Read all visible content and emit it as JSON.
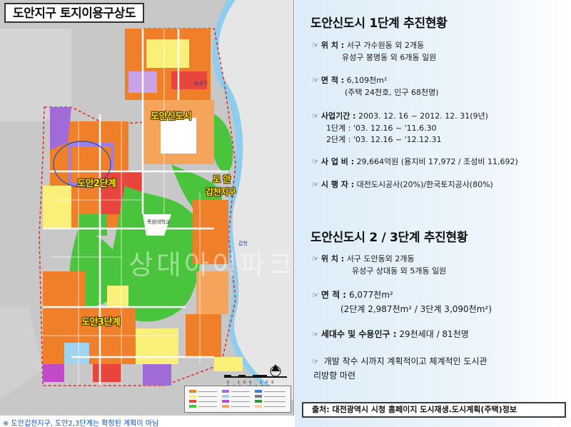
{
  "map": {
    "title": "도안지구 토지이용구상도",
    "zone_labels": {
      "phase1": "도안신도시",
      "phase2": "도안2단계",
      "phase3": "도안3단계",
      "gapcheon_line1": "도  안",
      "gapcheon_line2": "갑천지구"
    },
    "small_labels": {
      "university": "목원대학교",
      "river": "갑천",
      "station": "유성구"
    },
    "scale_text": "0 100 200 500 800M",
    "footnote": "※  도안갑천지구, 도안2,3단계는 확정된 계획이 아님"
  },
  "phase1": {
    "title": "도안신도시 1단계 추진현황",
    "location": {
      "label": "위 치 :",
      "line1": "서구 가수원동 외 2개동",
      "line2": "유성구 봉명동 외 6개동 일원"
    },
    "area": {
      "label": "면 적 :",
      "line1": "6,109천m²",
      "line2": "(주택 24천호, 인구 68천명)"
    },
    "period": {
      "label": "사업기간 :",
      "line1": "2003. 12. 16 ~ 2012. 12. 31(9년)",
      "line2": "1단계 : '03. 12.16 ~ '11.6.30",
      "line3": "2단계 : '03. 12.16 ~ '12.12.31"
    },
    "cost": {
      "label": "사 업 비 :",
      "line1": "29,664억원 (용지비 17,972 / 조성비 11,692)"
    },
    "executor": {
      "label": "시 행 자 :",
      "line1": "대전도시공사(20%)/한국토지공사(80%)"
    }
  },
  "phase23": {
    "title": "도안신도시 2 / 3단계 추진현황",
    "location": {
      "label": "위 치 :",
      "line1": "서구 도안동외 2개동",
      "line2": "유성구 상대동 외 5개동 일원"
    },
    "area": {
      "label": "면 적 :",
      "line1": "6,077천m²",
      "line2": "(2단계  2,987천m² / 3단계  3,090천m²)"
    },
    "households": {
      "label": "세대수 및 수용인구 :",
      "line1": "29천세대  / 81천명"
    },
    "plan": {
      "line1": "개발 착수 시까지 계획적이고 체계적인 도시관",
      "line2": "리방향 마련"
    }
  },
  "watermark": "상대아이파크",
  "source": "출처: 대전광역시 시청 홈페이지 도시재생.도시계획(주택)정보",
  "icons": {
    "bullet": "hand-pointing-icon"
  },
  "colors": {
    "residential": "#f07f2a",
    "green": "#49c43c",
    "river": "#9fd3f0",
    "commercial": "#e8453c",
    "apartment_low": "#f9f07a",
    "public": "#a06bd6"
  }
}
